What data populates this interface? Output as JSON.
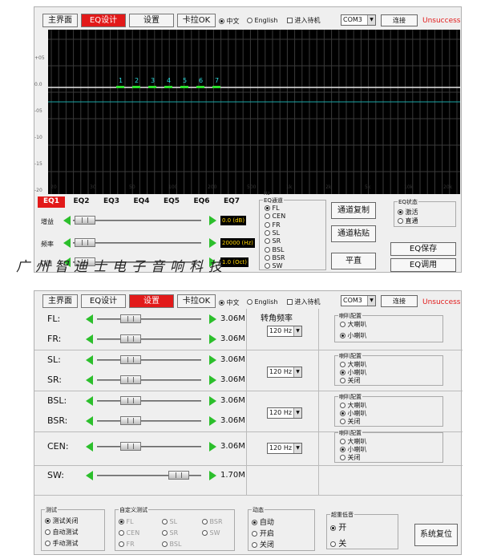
{
  "top": {
    "tabs": [
      {
        "label": "主界面",
        "active": false
      },
      {
        "label": "EQ设计",
        "active": true
      },
      {
        "label": "设置",
        "active": false
      },
      {
        "label": "卡拉OK",
        "active": false
      }
    ],
    "lang_chinese": "中文",
    "lang_english": "English",
    "standby": "进入待机",
    "port": "COM3",
    "connect": "连接",
    "status": "Unsuccess",
    "y_ticks": [
      "+05",
      "0.0",
      "-05",
      "-10",
      "-15",
      "-20"
    ],
    "x_ticks": [
      "20",
      "30",
      "50",
      "100",
      "200",
      "500",
      "1k",
      "2k",
      "5k",
      "10k",
      "20k"
    ],
    "x_unit": "Hz",
    "band_markers": [
      "1",
      "2",
      "3",
      "4",
      "5",
      "6",
      "7"
    ],
    "eq_tabs": [
      "EQ1",
      "EQ2",
      "EQ3",
      "EQ4",
      "EQ5",
      "EQ6",
      "EQ7"
    ],
    "gain_label": "增益",
    "freq_label": "频率",
    "q_label": "Q值",
    "gain_value": "0.0 (dB)",
    "freq_value": "20000 (Hz)",
    "q_value": "1.0 (Oct)",
    "channel_group": "EQ通道",
    "channels": [
      "FL",
      "CEN",
      "FR",
      "SL",
      "SR",
      "BSL",
      "BSR",
      "SW"
    ],
    "copy_btn": "通道复制",
    "paste_btn": "通道粘贴",
    "flat_btn": "平直",
    "eq_state_group": "EQ状态",
    "eq_state_on": "激活",
    "eq_state_off": "直通",
    "save_btn": "EQ保存",
    "load_btn": "EQ调用"
  },
  "watermark": "广州智迪士电子音响科技",
  "bottom": {
    "tabs": [
      {
        "label": "主界面",
        "active": false
      },
      {
        "label": "EQ设计",
        "active": false
      },
      {
        "label": "设置",
        "active": true
      },
      {
        "label": "卡拉OK",
        "active": false
      }
    ],
    "lang_chinese": "中文",
    "lang_english": "English",
    "standby": "进入待机",
    "port": "COM3",
    "connect": "连接",
    "status": "Unsuccess",
    "crossover_title": "转角频率",
    "rows": [
      {
        "label": "FL:",
        "value": "3.06M",
        "level": 0.25
      },
      {
        "label": "FR:",
        "value": "3.06M",
        "level": 0.25
      },
      {
        "label": "SL:",
        "value": "3.06M",
        "level": 0.25
      },
      {
        "label": "SR:",
        "value": "3.06M",
        "level": 0.25
      },
      {
        "label": "BSL:",
        "value": "3.06M",
        "level": 0.25
      },
      {
        "label": "BSR:",
        "value": "3.06M",
        "level": 0.25
      },
      {
        "label": "CEN:",
        "value": "3.06M",
        "level": 0.25
      },
      {
        "label": "SW:",
        "value": "1.70M",
        "level": 0.85
      }
    ],
    "crossover_values": [
      "120 Hz",
      "120 Hz",
      "120 Hz",
      "120 Hz"
    ],
    "speaker_group": "喇叭配置",
    "speaker_large": "大喇叭",
    "speaker_small": "小喇叭",
    "speaker_off": "关闭",
    "test_group": "测试",
    "test_opts": [
      "测试关闭",
      "自动测试",
      "手动测试"
    ],
    "custom_group": "自定义测试",
    "custom_opts": [
      "FL",
      "SL",
      "BSR",
      "CEN",
      "SR",
      "SW",
      "FR",
      "BSL"
    ],
    "dynamic_group": "动态",
    "dynamic_opts": [
      "自动",
      "开启",
      "关闭"
    ],
    "bass_group": "超重低音",
    "bass_opts": [
      "开",
      "关"
    ],
    "reset_btn": "系统复位"
  }
}
